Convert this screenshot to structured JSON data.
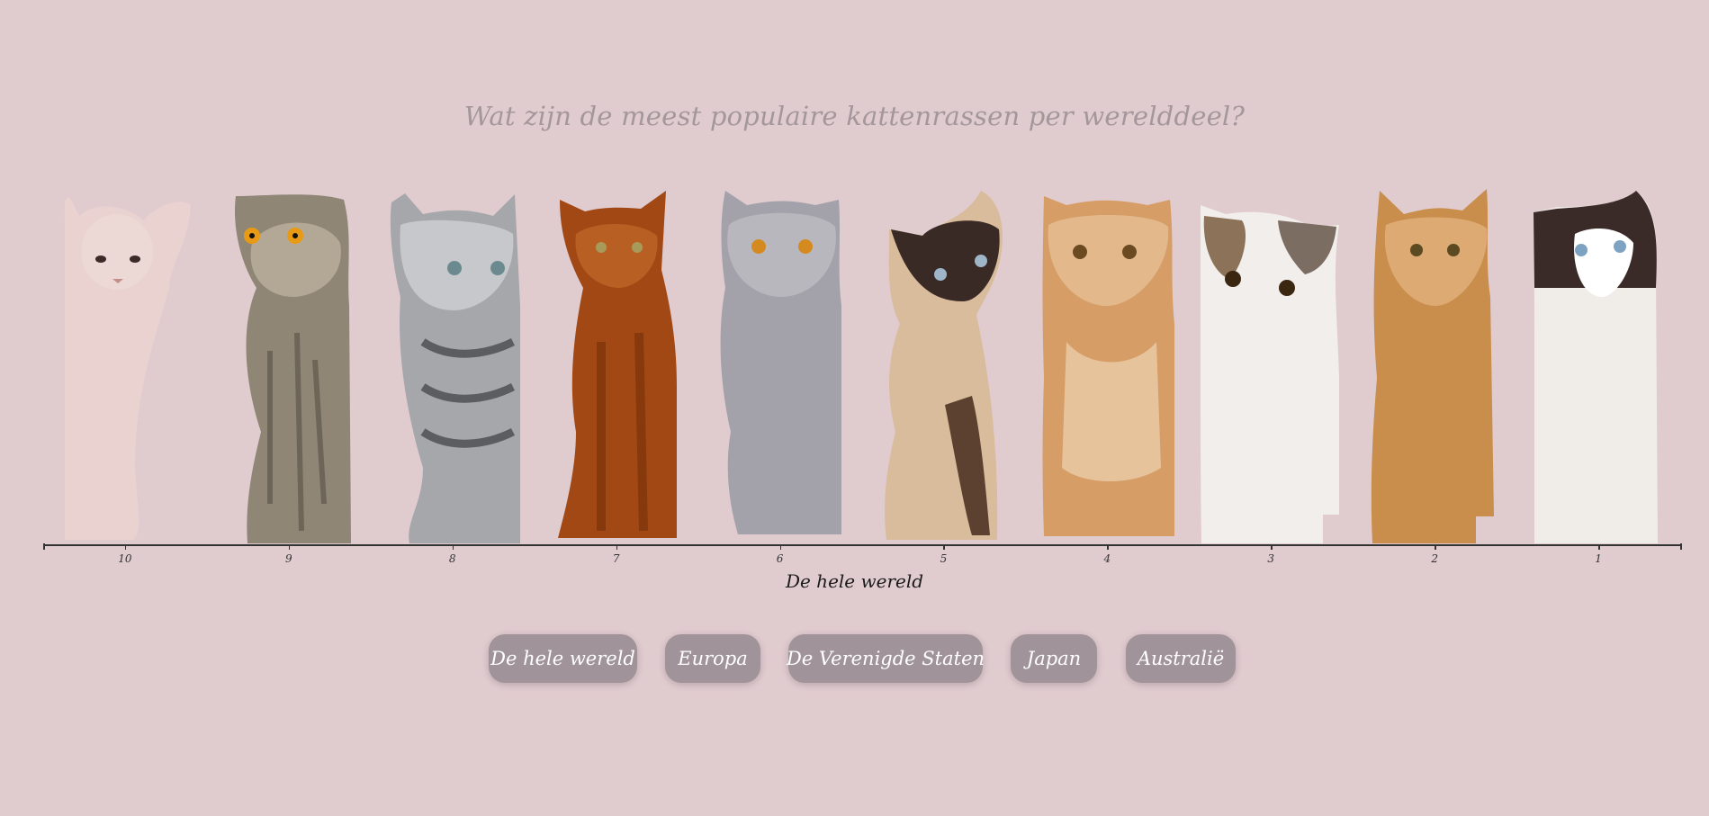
{
  "page": {
    "title": "Wat zijn de meest populaire kattenrassen per werelddeel?"
  },
  "chart_data": {
    "type": "bar",
    "xlabel": "De hele wereld",
    "ticks": [
      "10",
      "9",
      "8",
      "7",
      "6",
      "5",
      "4",
      "3",
      "2",
      "1"
    ],
    "categories": [
      {
        "rank": "10",
        "breed_icon": "sphynx-cat-image"
      },
      {
        "rank": "9",
        "breed_icon": "scottish-fold-cat-image"
      },
      {
        "rank": "8",
        "breed_icon": "american-shorthair-cat-image"
      },
      {
        "rank": "7",
        "breed_icon": "abyssinian-cat-image"
      },
      {
        "rank": "6",
        "breed_icon": "british-shorthair-cat-image"
      },
      {
        "rank": "5",
        "breed_icon": "devon-rex-cat-image"
      },
      {
        "rank": "4",
        "breed_icon": "persian-cat-image"
      },
      {
        "rank": "3",
        "breed_icon": "exotic-shorthair-cat-image"
      },
      {
        "rank": "2",
        "breed_icon": "maine-coon-cat-image"
      },
      {
        "rank": "1",
        "breed_icon": "ragdoll-cat-image"
      }
    ]
  },
  "filters": {
    "buttons": [
      "De hele wereld",
      "Europa",
      "De Verenigde Staten",
      "Japan",
      "Australië"
    ]
  },
  "colors": {
    "background": "#e0cbcf",
    "button": "#a1939a",
    "title": "#a4979b"
  }
}
